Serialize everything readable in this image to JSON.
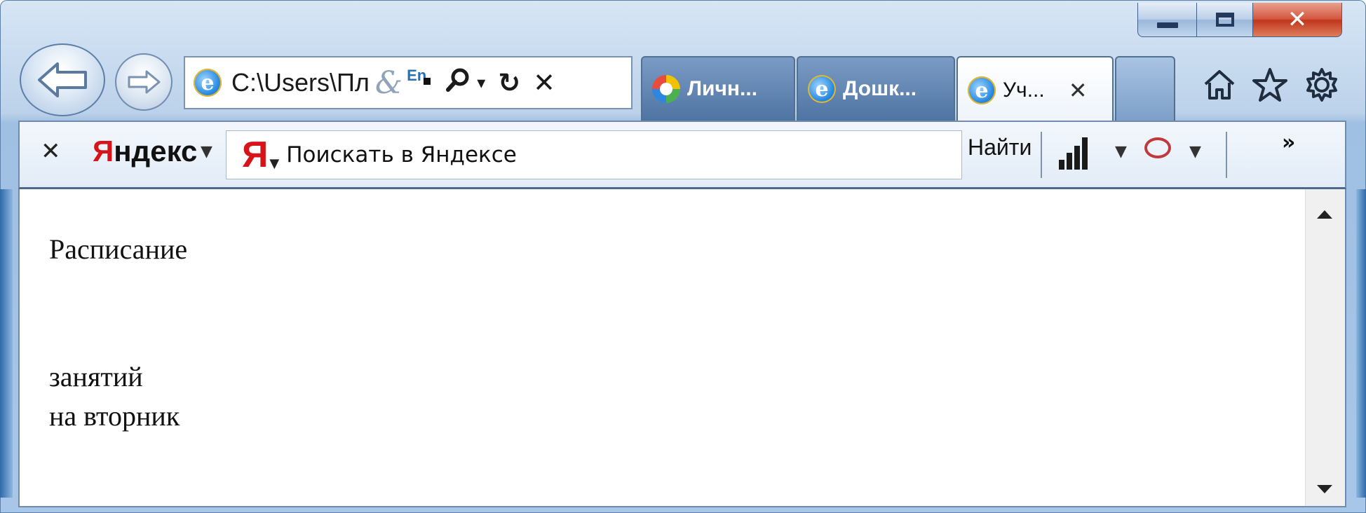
{
  "address_bar": {
    "path": "C:\\Users\\Пл",
    "amp_glyph": "&",
    "lang_badge": "En"
  },
  "tabs": [
    {
      "label": "Личн..."
    },
    {
      "label": "Дошк..."
    },
    {
      "label": "Уч...",
      "close": "✕"
    }
  ],
  "toolbar": {
    "close": "✕",
    "logo_first": "Я",
    "logo_rest": "ндекс",
    "search_placeholder": "Поискать в Яндексе",
    "find_label": "Найти",
    "more": "»"
  },
  "content": {
    "line1": "Расписание",
    "line2": "занятий",
    "line3": "на вторник"
  },
  "colors": {
    "accent_red": "#d6141a",
    "chrome_blue": "#9fbfe3"
  }
}
